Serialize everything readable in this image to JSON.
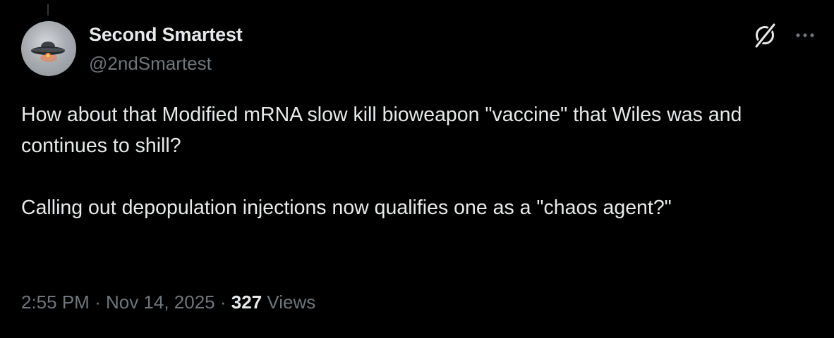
{
  "author": {
    "name": "Second Smartest",
    "handle": "@2ndSmartest"
  },
  "icons": {
    "avatar": "ufo-avatar",
    "grok": "grok-icon",
    "more": "more-options-icon"
  },
  "tweet": {
    "paragraphs": [
      "How about that Modified mRNA slow kill bioweapon \"vaccine\" that Wiles was and continues to shill?",
      "Calling out depopulation injections now qualifies one as a \"chaos agent?\""
    ]
  },
  "meta": {
    "time": "2:55 PM",
    "separator": "·",
    "date": "Nov 14, 2025",
    "views_count": "327",
    "views_label": "Views"
  },
  "colors": {
    "background": "#000000",
    "primary_text": "#e7e9ea",
    "secondary_text": "#71767b"
  }
}
